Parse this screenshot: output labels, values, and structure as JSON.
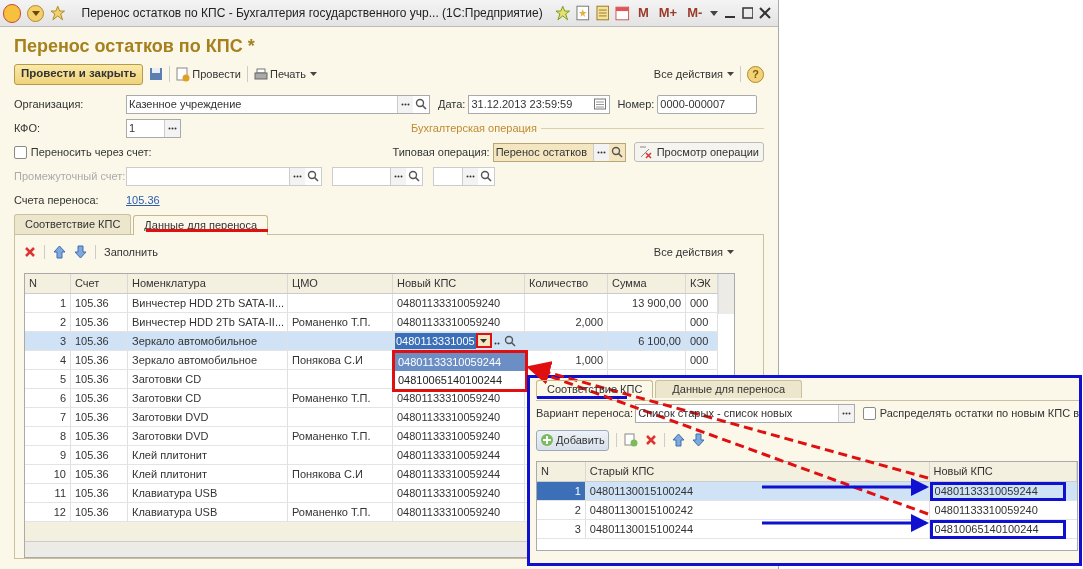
{
  "title_bar": {
    "title": "Перенос остатков по КПС - Бухгалтерия государственного учр...  (1С:Предприятие)",
    "memory_buttons": [
      "M",
      "M+",
      "M-"
    ]
  },
  "form_title": "Перенос остатков по КПС *",
  "help": "?",
  "toolbar": {
    "primary": "Провести и закрыть",
    "post": "Провести",
    "print": "Печать",
    "all_actions": "Все действия"
  },
  "organization": {
    "label": "Организация:",
    "value": "Казенное учреждение"
  },
  "date": {
    "label": "Дата:",
    "value": "31.12.2013 23:59:59"
  },
  "number": {
    "label": "Номер:",
    "value": "0000-000007"
  },
  "kfo": {
    "label": "КФО:",
    "value": "1"
  },
  "operation_group": "Бухгалтерская операция",
  "transfer_via_account": {
    "label": "Переносить через счет:",
    "checked": false
  },
  "typical_operation": {
    "label": "Типовая операция:",
    "value": "Перенос остатков"
  },
  "view_operation": "Просмотр операции",
  "intermediate_account": {
    "label": "Промежуточный счет:",
    "disabled": true
  },
  "transfer_accounts": {
    "label": "Счета переноса:",
    "link": "105.36"
  },
  "tabs": [
    {
      "label": "Соответствие КПС",
      "selected": false
    },
    {
      "label": "Данные для переноса",
      "selected": true
    }
  ],
  "table_toolbar": {
    "fill": "Заполнить",
    "all_actions": "Все действия"
  },
  "table": {
    "columns": [
      "N",
      "Счет",
      "Номенклатура",
      "ЦМО",
      "Новый КПС",
      "Количество",
      "Сумма",
      "КЭК"
    ],
    "rows": [
      {
        "n": "1",
        "account": "105.36",
        "item": "Винчестер HDD 2Tb SATA-II...",
        "new_kps": "04801133310059240",
        "sum": "13 900,00",
        "kek": "000",
        "selected": false
      },
      {
        "n": "2",
        "account": "105.36",
        "item": "Винчестер HDD 2Tb SATA-II...",
        "cmo": "Романенко Т.П.",
        "new_kps": "04801133310059240",
        "qty": "2,000",
        "kek": "000",
        "selected": false
      },
      {
        "n": "3",
        "account": "105.36",
        "item": "Зеркало автомобильное",
        "new_kps": "0480113331005",
        "sum": "6 100,00",
        "kek": "000",
        "selected": true
      },
      {
        "n": "4",
        "account": "105.36",
        "item": "Зеркало автомобильное",
        "cmo": "Понякова С.И",
        "qty": "1,000",
        "kek": "000",
        "selected": false
      },
      {
        "n": "5",
        "account": "105.36",
        "item": "Заготовки CD",
        "selected": false
      },
      {
        "n": "6",
        "account": "105.36",
        "item": "Заготовки CD",
        "cmo": "Романенко Т.П.",
        "new_kps": "04801133310059240",
        "selected": false
      },
      {
        "n": "7",
        "account": "105.36",
        "item": "Заготовки DVD",
        "new_kps": "04801133310059240",
        "selected": false
      },
      {
        "n": "8",
        "account": "105.36",
        "item": "Заготовки DVD",
        "cmo": "Романенко Т.П.",
        "new_kps": "04801133310059240",
        "selected": false
      },
      {
        "n": "9",
        "account": "105.36",
        "item": "Клей плитонит",
        "new_kps": "04801133310059244",
        "selected": false
      },
      {
        "n": "10",
        "account": "105.36",
        "item": "Клей плитонит",
        "cmo": "Понякова С.И",
        "new_kps": "04801133310059244",
        "selected": false
      },
      {
        "n": "11",
        "account": "105.36",
        "item": "Клавиатура USB",
        "new_kps": "04801133310059240",
        "selected": false
      },
      {
        "n": "12",
        "account": "105.36",
        "item": "Клавиатура USB",
        "cmo": "Романенко Т.П.",
        "new_kps": "04801133310059240",
        "selected": false
      }
    ]
  },
  "dropdown": [
    {
      "label": "04801133310059244",
      "selected": true
    },
    {
      "label": "04810065140100244",
      "selected": false
    }
  ],
  "inset": {
    "tabs": [
      {
        "label": "Соответствие КПС",
        "selected": true
      },
      {
        "label": "Данные для переноса",
        "selected": false
      }
    ],
    "variant": {
      "label": "Вариант переноса:",
      "value": "Список старых - список новых"
    },
    "distribute": {
      "label": "Распределять остатки по новым КПС в",
      "checked": false
    },
    "add": "Добавить",
    "columns": [
      "N",
      "Старый КПС",
      "Новый КПС"
    ],
    "rows": [
      {
        "n": "1",
        "old": "04801130015100244",
        "new": "04801133310059244",
        "selected": true,
        "framed": true
      },
      {
        "n": "2",
        "old": "04801130015100242",
        "new": "04801133310059240",
        "selected": false,
        "framed": false
      },
      {
        "n": "3",
        "old": "04801130015100244",
        "new": "04810065140100244",
        "selected": false,
        "framed": true
      }
    ]
  }
}
